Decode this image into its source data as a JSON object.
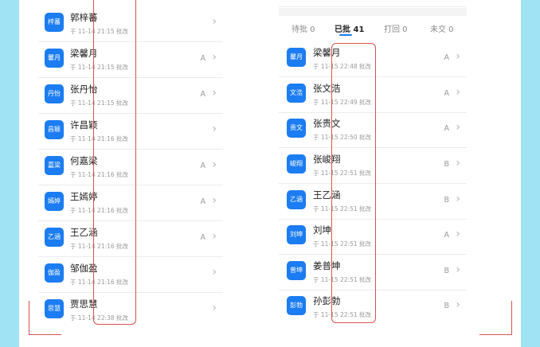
{
  "left_list": {
    "items": [
      {
        "avatar": "梓蕃",
        "name": "郭梓蕃",
        "time": "于 11-14 21:15 批改",
        "grade": ""
      },
      {
        "avatar": "馨月",
        "name": "梁馨月",
        "time": "于 11-14 21:15 批改",
        "grade": "A"
      },
      {
        "avatar": "丹怡",
        "name": "张丹怡",
        "time": "于 11-14 21:15 批改",
        "grade": "A"
      },
      {
        "avatar": "昌颖",
        "name": "许昌颖",
        "time": "于 11-14 21:16 批改",
        "grade": ""
      },
      {
        "avatar": "嘉梁",
        "name": "何嘉梁",
        "time": "于 11-14 21:16 批改",
        "grade": "A"
      },
      {
        "avatar": "嫣婷",
        "name": "王嫣婷",
        "time": "于 11-14 21:16 批改",
        "grade": "A"
      },
      {
        "avatar": "乙涵",
        "name": "王乙涵",
        "time": "于 11-14 21:16 批改",
        "grade": "A"
      },
      {
        "avatar": "伽盈",
        "name": "邹伽盈",
        "time": "于 11-14 21:16 批改",
        "grade": ""
      },
      {
        "avatar": "思慧",
        "name": "贾思慧",
        "time": "于 11-14 22:38 批改",
        "grade": ""
      }
    ]
  },
  "right_panel": {
    "tabs": [
      {
        "label": "待批 0",
        "active": false
      },
      {
        "label": "已批 41",
        "active": true
      },
      {
        "label": "打回 0",
        "active": false
      },
      {
        "label": "未交 0",
        "active": false
      }
    ],
    "items": [
      {
        "avatar": "馨月",
        "name": "梁馨月",
        "time": "于 11-15 22:48 批改",
        "grade": "A"
      },
      {
        "avatar": "文浩",
        "name": "张文浩",
        "time": "于 11-15 22:49 批改",
        "grade": "A"
      },
      {
        "avatar": "贵文",
        "name": "张贵文",
        "time": "于 11-15 22:50 批改",
        "grade": "A"
      },
      {
        "avatar": "峻翔",
        "name": "张峻翔",
        "time": "于 11-15 22:51 批改",
        "grade": "B"
      },
      {
        "avatar": "乙涵",
        "name": "王乙涵",
        "time": "于 11-15 22:51 批改",
        "grade": "B"
      },
      {
        "avatar": "刘坤",
        "name": "刘坤",
        "time": "于 11-15 22:51 批改",
        "grade": "A"
      },
      {
        "avatar": "普坤",
        "name": "姜普坤",
        "time": "于 11-15 22:51 批改",
        "grade": "B"
      },
      {
        "avatar": "彭勃",
        "name": "孙彭勃",
        "time": "于 11-15 22:51 批改",
        "grade": "B"
      }
    ]
  },
  "icons": {
    "chevron": "chevron-right-icon"
  },
  "colors": {
    "avatar": "#1c7cf2",
    "annotation": "#d9534f",
    "background": "#9fe3f5"
  }
}
